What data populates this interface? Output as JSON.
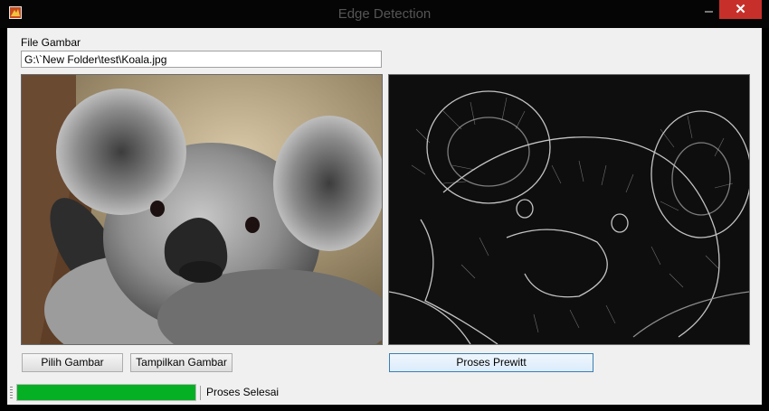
{
  "window": {
    "title": "Edge Detection",
    "close_glyph": "✕"
  },
  "file": {
    "label": "File Gambar",
    "path": "G:\\`New Folder\\test\\Koala.jpg"
  },
  "images": {
    "original_icon": "koala-photo",
    "edge_icon": "koala-edge-detected"
  },
  "buttons": {
    "pilih": "Pilih Gambar",
    "tampilkan": "Tampilkan Gambar",
    "prewitt": "Proses Prewitt"
  },
  "status": {
    "progress_fraction": 1.0,
    "text": "Proses Selesai",
    "accent": "#06b025"
  }
}
